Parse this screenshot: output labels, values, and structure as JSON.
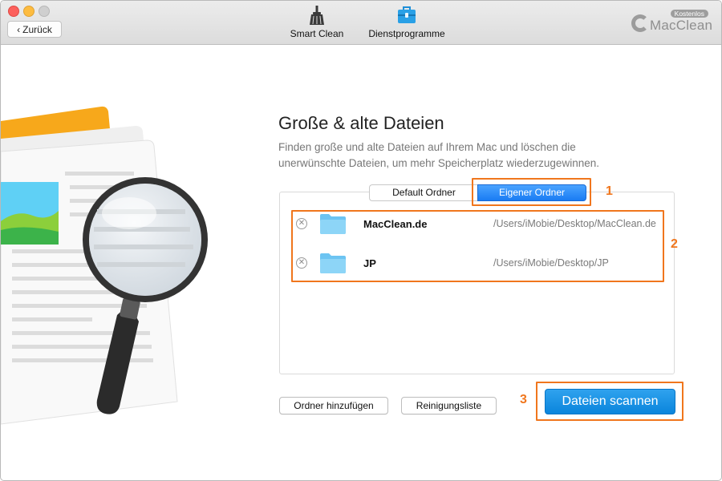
{
  "toolbar": {
    "back_label": "Zurück",
    "tabs": [
      {
        "label": "Smart Clean",
        "icon": "broom-icon"
      },
      {
        "label": "Dienstprogramme",
        "icon": "toolbox-icon"
      }
    ],
    "brand": {
      "name": "MacClean",
      "badge": "Kostenlos"
    }
  },
  "main": {
    "title": "Große & alte Dateien",
    "description": "Finden große und alte Dateien auf Ihrem Mac und löschen die unerwünschte Dateien, um mehr Speicherplatz wiederzugewinnen.",
    "segments": {
      "default": "Default Ordner",
      "custom": "Eigener Ordner",
      "selected": "Eigener Ordner"
    },
    "folders": [
      {
        "name": "MacClean.de",
        "path": "/Users/iMobie/Desktop/MacClean.de"
      },
      {
        "name": "JP",
        "path": "/Users/iMobie/Desktop/JP"
      }
    ],
    "buttons": {
      "add_folder": "Ordner hinzufügen",
      "clean_list": "Reinigungsliste",
      "scan": "Dateien scannen"
    }
  },
  "annotations": [
    "1",
    "2",
    "3"
  ],
  "colors": {
    "highlight": "#f0761d",
    "scan_button": "#1a8fe3",
    "selected_segment": "#2288f7",
    "folder": "#6cc4f2"
  }
}
